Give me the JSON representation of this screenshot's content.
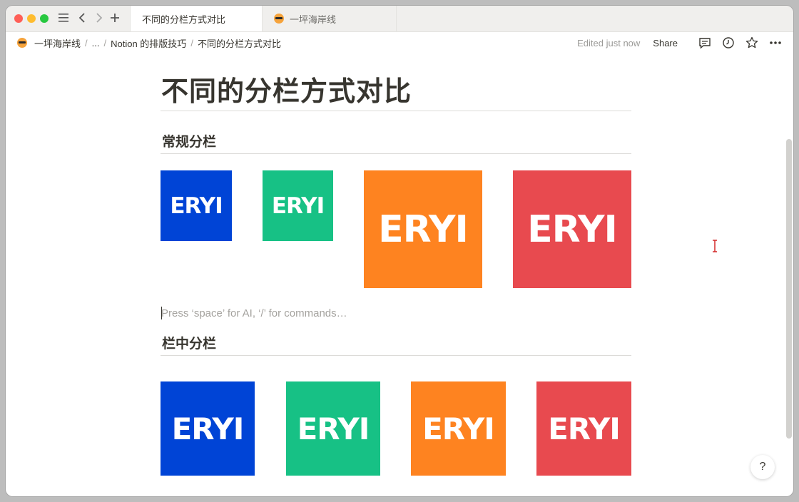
{
  "tabs": [
    {
      "label": "不同的分栏方式对比"
    },
    {
      "label": "一坪海岸线"
    }
  ],
  "breadcrumb": {
    "items": [
      "一坪海岸线",
      "...",
      "Notion 的排版技巧",
      "不同的分栏方式对比"
    ],
    "separator": "/"
  },
  "topbar": {
    "edited": "Edited just now",
    "share": "Share"
  },
  "page": {
    "title": "不同的分栏方式对比",
    "section1": "常规分栏",
    "section2": "栏中分栏",
    "placeholder": "Press ‘space’ for AI, ‘/’ for commands…",
    "help": "?"
  },
  "tiles": {
    "text": "ERYI",
    "colors": {
      "blue": "#0044d6",
      "green": "#17c185",
      "orange": "#fe8320",
      "red": "#e84a4f"
    }
  },
  "icons": [
    "sidebar-toggle-icon",
    "back-icon",
    "forward-icon",
    "new-tab-icon",
    "comment-icon",
    "clock-icon",
    "star-icon",
    "more-icon",
    "help-icon"
  ]
}
